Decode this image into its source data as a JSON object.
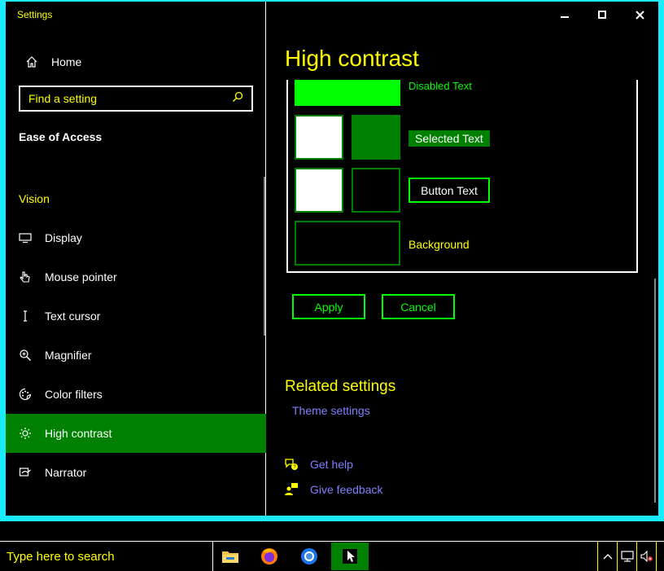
{
  "window": {
    "title": "Settings"
  },
  "sidebar": {
    "home": "Home",
    "search_placeholder": "Find a setting",
    "section": "Ease of Access",
    "group": "Vision",
    "items": [
      {
        "label": "Display",
        "icon": "display-icon"
      },
      {
        "label": "Mouse pointer",
        "icon": "mouse-pointer-icon"
      },
      {
        "label": "Text cursor",
        "icon": "text-cursor-icon"
      },
      {
        "label": "Magnifier",
        "icon": "magnifier-icon"
      },
      {
        "label": "Color filters",
        "icon": "color-filters-icon"
      },
      {
        "label": "High contrast",
        "icon": "high-contrast-icon",
        "active": true
      },
      {
        "label": "Narrator",
        "icon": "narrator-icon"
      }
    ]
  },
  "main": {
    "title": "High contrast",
    "samples": {
      "disabled_text": "Disabled Text",
      "selected_text": "Selected Text",
      "button_text": "Button Text",
      "background": "Background"
    },
    "apply": "Apply",
    "cancel": "Cancel",
    "related_title": "Related settings",
    "theme_settings": "Theme settings",
    "get_help": "Get help",
    "give_feedback": "Give feedback"
  },
  "taskbar": {
    "search_placeholder": "Type here to search"
  },
  "colors": {
    "accent_green": "#008000",
    "bright_green": "#00ff00",
    "text_yellow": "#ffff00",
    "hyperlink": "#8080ff",
    "frame_cyan": "#1aebff"
  }
}
